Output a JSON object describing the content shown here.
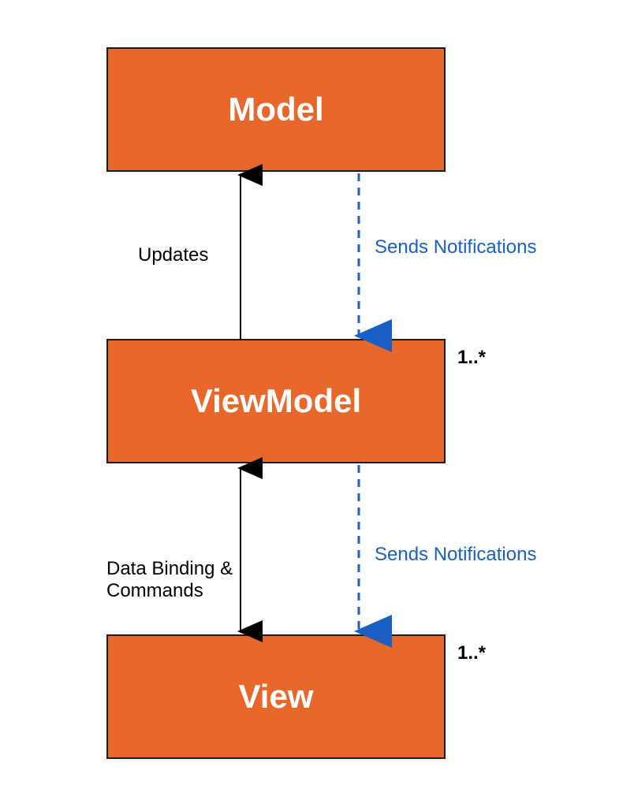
{
  "boxes": {
    "model": "Model",
    "viewmodel": "ViewModel",
    "view": "View"
  },
  "multiplicities": {
    "viewmodel": "1..*",
    "view": "1..*"
  },
  "labels": {
    "updates": "Updates",
    "notifications1": "Sends Notifications",
    "databinding": "Data Binding &\nCommands",
    "notifications2": "Sends Notifications"
  },
  "colors": {
    "box_fill": "#e8682c",
    "box_border": "#1a1a1a",
    "label_blue": "#1a5fc4",
    "label_black": "#000000",
    "arrow_black": "#000000",
    "arrow_blue": "#1a5fc4"
  }
}
